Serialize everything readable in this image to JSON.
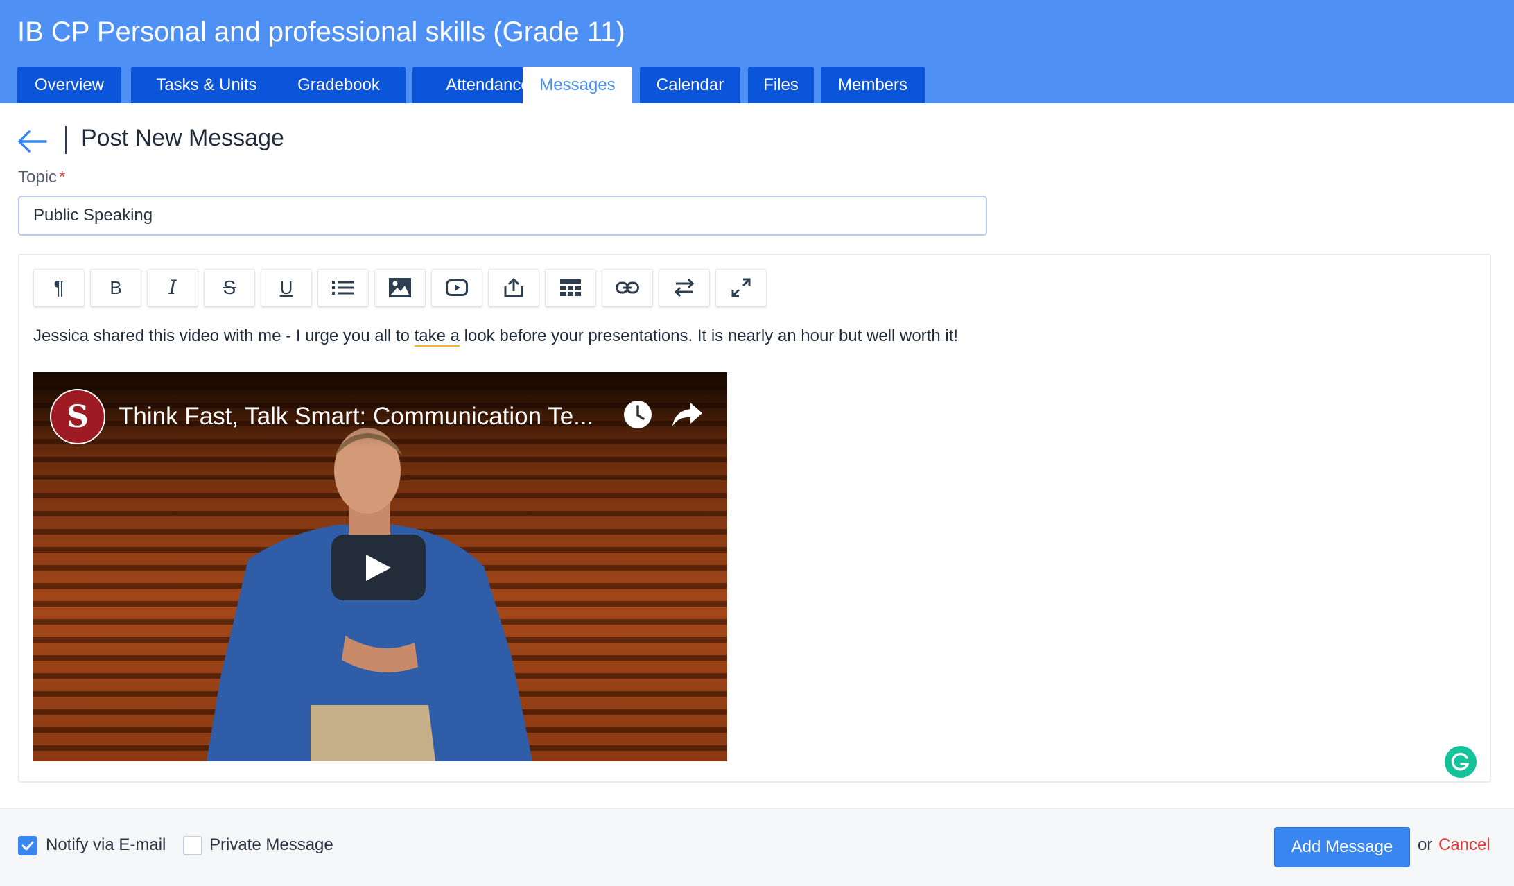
{
  "course": {
    "title": "IB CP Personal and professional skills (Grade 11)"
  },
  "tabs": [
    {
      "label": "Overview",
      "active": false
    },
    {
      "label": "Tasks & Units",
      "active": false
    },
    {
      "label": "Gradebook",
      "active": false
    },
    {
      "label": "Attendance",
      "active": false
    },
    {
      "label": "Messages",
      "active": true
    },
    {
      "label": "Calendar",
      "active": false
    },
    {
      "label": "Files",
      "active": false
    },
    {
      "label": "Members",
      "active": false
    }
  ],
  "page": {
    "title": "Post New Message",
    "back_icon": "arrow-left-icon"
  },
  "topic": {
    "label": "Topic",
    "required_mark": "*",
    "value": "Public Speaking"
  },
  "toolbar": {
    "buttons": [
      {
        "name": "paragraph-format-button",
        "icon": "pilcrow-icon"
      },
      {
        "name": "bold-button",
        "icon": "bold-icon"
      },
      {
        "name": "italic-button",
        "icon": "italic-icon"
      },
      {
        "name": "strikethrough-button",
        "icon": "strikethrough-icon"
      },
      {
        "name": "underline-button",
        "icon": "underline-icon"
      },
      {
        "name": "list-button",
        "icon": "list-icon"
      },
      {
        "name": "insert-image-button",
        "icon": "image-icon"
      },
      {
        "name": "insert-video-button",
        "icon": "video-icon"
      },
      {
        "name": "upload-file-button",
        "icon": "upload-icon"
      },
      {
        "name": "insert-table-button",
        "icon": "table-icon"
      },
      {
        "name": "insert-link-button",
        "icon": "link-icon"
      },
      {
        "name": "text-direction-button",
        "icon": "swap-arrows-icon"
      },
      {
        "name": "fullscreen-button",
        "icon": "expand-icon"
      }
    ]
  },
  "editor": {
    "text_before": "Jessica shared this video with me - I urge you all to ",
    "text_flagged": "take a",
    "text_after": " look before your presentations. It is nearly an hour but well worth it!"
  },
  "video": {
    "title": "Think Fast, Talk Smart: Communication Te...",
    "channel_logo_letter": "S",
    "channel_logo_icon": "stanford-business-logo",
    "watch_later_icon": "clock-icon",
    "share_icon": "share-arrow-icon",
    "play_icon": "play-icon"
  },
  "footer": {
    "notify_label": "Notify via E-mail",
    "notify_checked": true,
    "private_label": "Private Message",
    "private_checked": false,
    "submit_label": "Add Message",
    "or_text": "or",
    "cancel_label": "Cancel"
  },
  "colors": {
    "header": "#4f90f5",
    "tab": "#0a55d9",
    "primary_button": "#3a86f0",
    "cancel": "#e03b3b",
    "grammarly": "#15c39a"
  }
}
